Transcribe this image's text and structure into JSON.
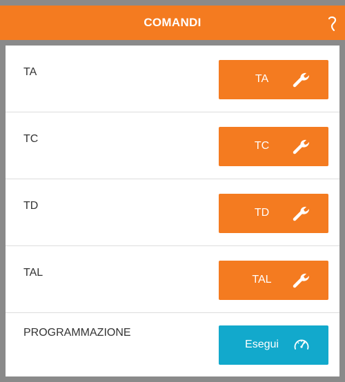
{
  "header": {
    "title": "COMANDI"
  },
  "rows": [
    {
      "label": "TA",
      "button": "TA"
    },
    {
      "label": "TC",
      "button": "TC"
    },
    {
      "label": "TD",
      "button": "TD"
    },
    {
      "label": "TAL",
      "button": "TAL"
    },
    {
      "label": "PROGRAMMAZIONE",
      "button": "Esegui"
    }
  ],
  "colors": {
    "accent": "#f47b20",
    "action_blue": "#12a9cc",
    "frame": "#8a8a8a"
  },
  "icons": {
    "help": "help-icon",
    "wrench": "wrench-icon",
    "speedometer": "speedometer-icon"
  }
}
